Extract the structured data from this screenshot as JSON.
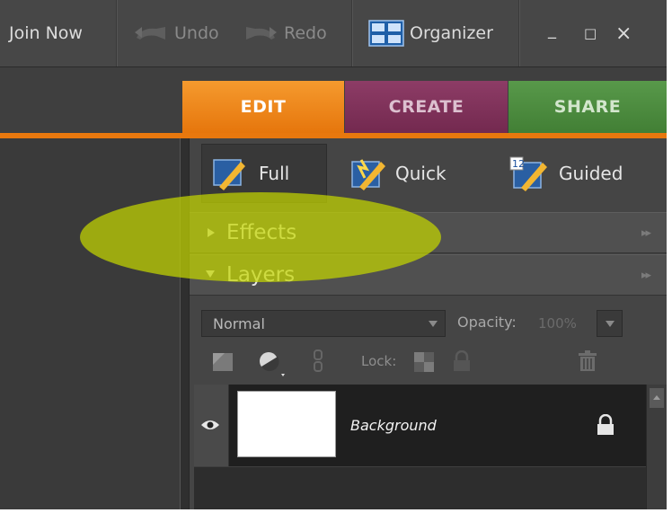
{
  "topbar": {
    "join_now": "Join Now",
    "undo": "Undo",
    "redo": "Redo",
    "organizer": "Organizer",
    "minimize": "_",
    "maximize": "□",
    "close": "×"
  },
  "mode_tabs": [
    {
      "label": "EDIT",
      "active": true,
      "color": "#ee7a10"
    },
    {
      "label": "CREATE",
      "active": false,
      "color": "#7e3358"
    },
    {
      "label": "SHARE",
      "active": false,
      "color": "#4a8a3c"
    }
  ],
  "edit_modes": {
    "full": "Full",
    "quick": "Quick",
    "guided": "Guided"
  },
  "panels": {
    "effects": "Effects",
    "layers": "Layers"
  },
  "layers": {
    "blend_mode": "Normal",
    "opacity_label": "Opacity:",
    "opacity_value": "100%",
    "lock_label": "Lock:",
    "items": [
      {
        "name": "Background",
        "visible": true,
        "locked": true
      }
    ]
  },
  "colors": {
    "accent": "#e8780e",
    "highlight": "#c4d600"
  }
}
